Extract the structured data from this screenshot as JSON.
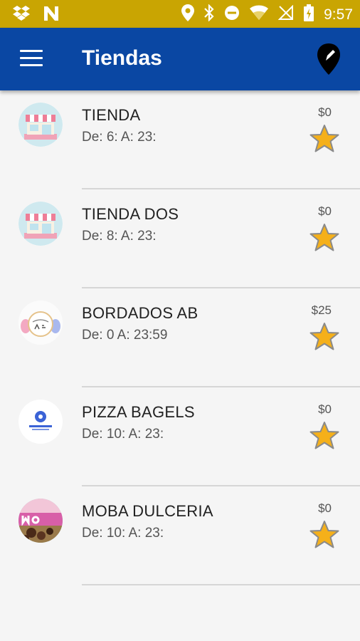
{
  "status_bar": {
    "time": "9:57",
    "icons": [
      "dropbox-icon",
      "n-app-icon",
      "location-icon",
      "bluetooth-icon",
      "do-not-disturb-icon",
      "wifi-icon",
      "no-signal-icon",
      "battery-charging-icon"
    ]
  },
  "header": {
    "title": "Tiendas",
    "menu_icon": "hamburger-menu-icon",
    "map_icon": "map-pin-icon"
  },
  "stores": [
    {
      "name": "TIENDA",
      "hours": "De: 6: A: 23:",
      "price": "$0",
      "logo": "storefront-logo"
    },
    {
      "name": "TIENDA DOS",
      "hours": "De: 8: A: 23:",
      "price": "$0",
      "logo": "storefront-logo"
    },
    {
      "name": "BORDADOS AB",
      "hours": "De: 0 A: 23:59",
      "price": "$25",
      "logo": "bordados-logo"
    },
    {
      "name": "PIZZA BAGELS",
      "hours": "De: 10: A: 23:",
      "price": "$0",
      "logo": "pizza-bagels-logo"
    },
    {
      "name": "MOBA DULCERIA",
      "hours": "De: 10: A: 23:",
      "price": "$0",
      "logo": "moba-logo"
    }
  ],
  "colors": {
    "status_bar": "#c9a502",
    "app_bar": "#0a47a3",
    "star": "#f5b01a"
  }
}
